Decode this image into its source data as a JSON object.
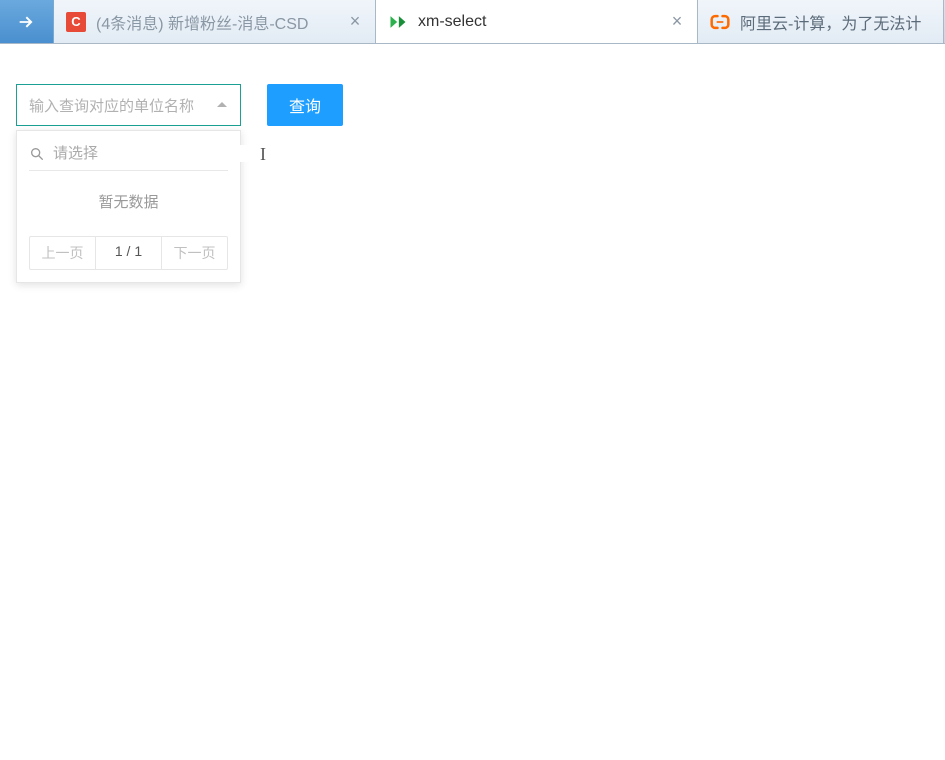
{
  "tabs": [
    {
      "title": "(4条消息) 新增粉丝-消息-CSD",
      "favicon_letter": "C"
    },
    {
      "title": "xm-select"
    },
    {
      "title": "阿里云-计算，为了无法计"
    }
  ],
  "select": {
    "placeholder": "输入查询对应的单位名称"
  },
  "query_button_label": "查询",
  "dropdown": {
    "search_placeholder": "请选择",
    "empty_text": "暂无数据",
    "prev_label": "上一页",
    "page_text": "1 / 1",
    "next_label": "下一页"
  }
}
